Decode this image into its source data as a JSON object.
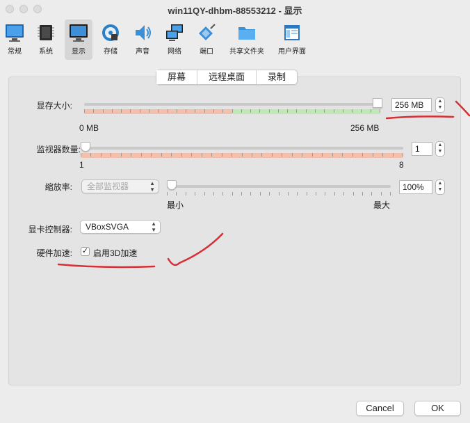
{
  "window": {
    "title": "win11QY-dhbm-88553212 - 显示"
  },
  "toolbar": {
    "items": [
      {
        "label": "常规",
        "icon": "general-icon"
      },
      {
        "label": "系统",
        "icon": "chip-icon"
      },
      {
        "label": "显示",
        "icon": "monitor-icon",
        "active": true
      },
      {
        "label": "存储",
        "icon": "disk-icon"
      },
      {
        "label": "声音",
        "icon": "speaker-icon"
      },
      {
        "label": "网络",
        "icon": "network-icon"
      },
      {
        "label": "端口",
        "icon": "port-icon"
      },
      {
        "label": "共享文件夹",
        "icon": "folder-icon"
      },
      {
        "label": "用户界面",
        "icon": "window-icon"
      }
    ]
  },
  "tabs": [
    {
      "label": "屏幕",
      "active": true
    },
    {
      "label": "远程桌面",
      "active": false
    },
    {
      "label": "录制",
      "active": false
    }
  ],
  "video_memory": {
    "label": "显存大小:",
    "value": "256 MB",
    "min_label": "0 MB",
    "max_label": "256 MB",
    "level": 1.0
  },
  "monitors": {
    "label": "监视器数量:",
    "value": "1",
    "min_label": "1",
    "max_label": "8",
    "level": 0.0
  },
  "scale": {
    "label": "缩放率:",
    "monitor_select": "全部监视器",
    "value": "100%",
    "min_label": "最小",
    "max_label": "最大",
    "level": 0.0
  },
  "graphics_controller": {
    "label": "显卡控制器:",
    "value": "VBoxSVGA"
  },
  "acceleration": {
    "label": "硬件加速:",
    "checkbox_label": "启用3D加速",
    "checked": true
  },
  "buttons": {
    "cancel": "Cancel",
    "ok": "OK"
  },
  "colors": {
    "range_bad": "#f2c0ad",
    "range_good": "#bfe8b2",
    "annotation": "#d62f35"
  }
}
